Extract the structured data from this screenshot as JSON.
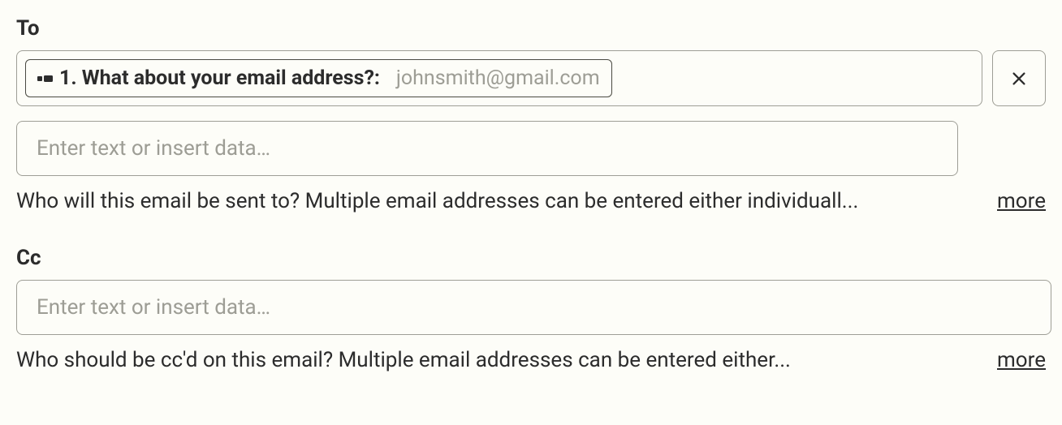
{
  "fields": {
    "to": {
      "label": "To",
      "chip": {
        "label": "1. What about your email address?:",
        "value": "johnsmith@gmail.com"
      },
      "input_placeholder": "Enter text or insert data…",
      "help_text": "Who will this email be sent to? Multiple email addresses can be entered either individuall...",
      "more_label": "more"
    },
    "cc": {
      "label": "Cc",
      "input_placeholder": "Enter text or insert data…",
      "help_text": "Who should be cc'd on this email? Multiple email addresses can be entered either...",
      "more_label": "more"
    }
  }
}
